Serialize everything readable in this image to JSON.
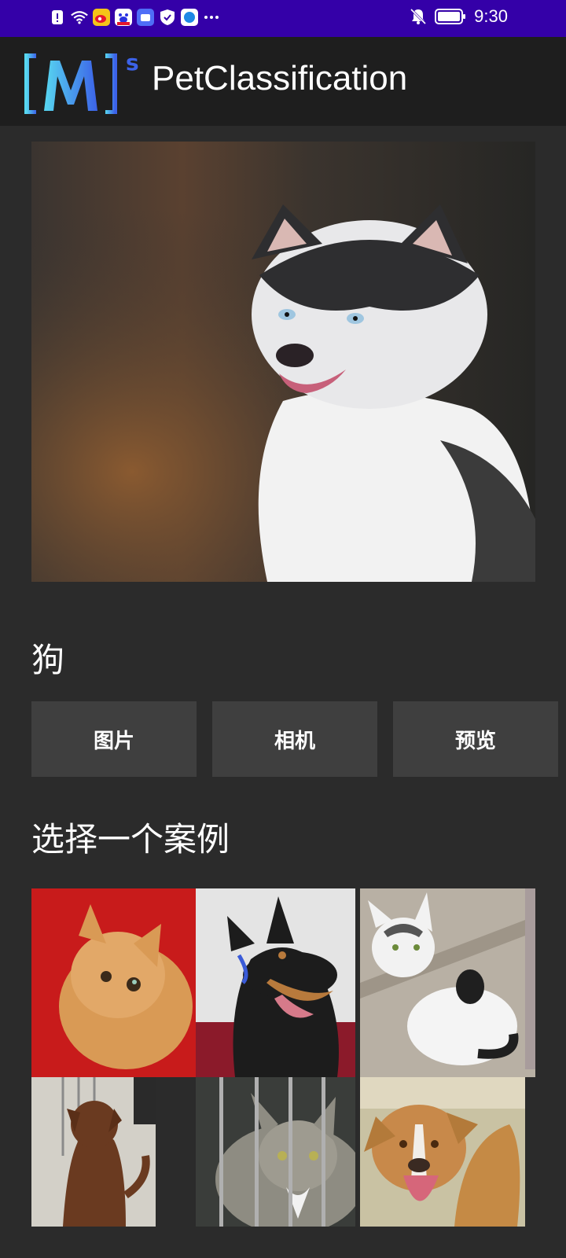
{
  "status_bar": {
    "time": "9:30",
    "left_icons": [
      "alert-icon",
      "wifi-icon",
      "weibo-icon",
      "baidu-icon",
      "app-icon",
      "shield-icon",
      "browser-icon",
      "more-icon"
    ],
    "right_icons": [
      "mute-icon",
      "battery-icon"
    ],
    "background": "#3400a8"
  },
  "app_bar": {
    "logo_text": "[M]s",
    "title": "PetClassification",
    "background": "#1e1e1e"
  },
  "main": {
    "result_label": "狗",
    "buttons": {
      "image": "图片",
      "camera": "相机",
      "preview": "预览"
    },
    "examples_title": "选择一个案例",
    "examples": [
      "orange-cat",
      "doberman-dog",
      "white-black-cat",
      "brown-dog",
      "tabby-cat-behind-bars",
      "pitbull-dog"
    ]
  },
  "colors": {
    "background": "#2b2b2b",
    "button": "#3f3f3f",
    "accent_logo": "#4a9cf0"
  }
}
